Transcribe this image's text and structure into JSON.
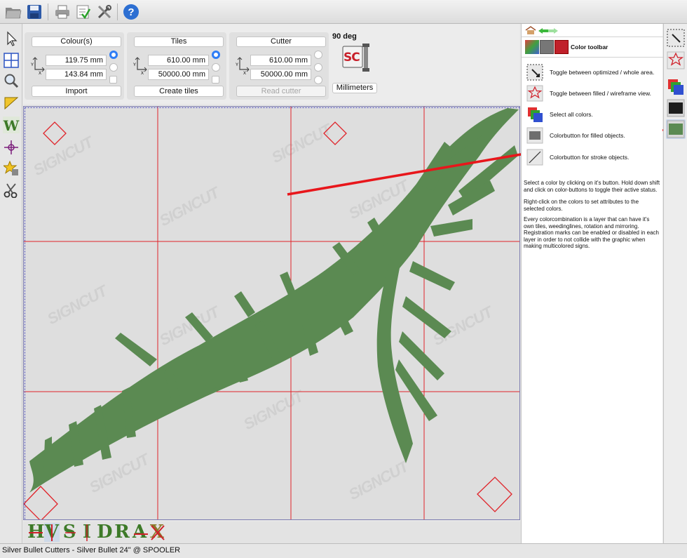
{
  "params": {
    "colours": {
      "title": "Colour(s)",
      "x_value": "119.75 mm",
      "y_value": "143.84 mm",
      "button": "Import"
    },
    "tiles": {
      "title": "Tiles",
      "x_value": "610.00 mm",
      "y_value": "50000.00 mm",
      "button": "Create tiles"
    },
    "cutter": {
      "title": "Cutter",
      "x_value": "610.00 mm",
      "y_value": "50000.00 mm",
      "button": "Read cutter"
    },
    "rotation": "90 deg",
    "logo_text": "SC",
    "units_button": "Millimeters"
  },
  "info_panel": {
    "title": "Color toolbar",
    "items": [
      {
        "icon": "toggle-area-icon",
        "text": "Toggle between optimized / whole area."
      },
      {
        "icon": "star-outline-icon",
        "text": "Toggle between filled / wireframe view."
      },
      {
        "icon": "color-layers-icon",
        "text": "Select all colors."
      },
      {
        "icon": "filled-color-icon",
        "text": "Colorbutton for filled objects."
      },
      {
        "icon": "stroke-line-icon",
        "text": "Colorbutton for stroke objects."
      }
    ],
    "paragraphs": [
      "Select a color by clicking on it's button. Hold down shift and click on color-buttons to toggle their active status.",
      "Right-click on the colors to set attributes to the selected colors.",
      "Every colorcombination is a layer that can have it's own tiles, weedinglines, rotation and mirroring. Registration marks can be enabled or disabled in each layer in order to not collide with the graphic when making multicolored signs."
    ]
  },
  "bottom_tools": [
    "H",
    "V",
    "S",
    "I",
    "D",
    "R",
    "A",
    "X"
  ],
  "watermark": "SIGNCUT",
  "status": "Silver Bullet Cutters - Silver Bullet 24\" @ SPOOLER",
  "colors": {
    "graphic_fill": "#5b8a52",
    "tile_lines": "#e0242a",
    "arrow": "#e8161b",
    "radio_accent": "#2e7df6"
  }
}
